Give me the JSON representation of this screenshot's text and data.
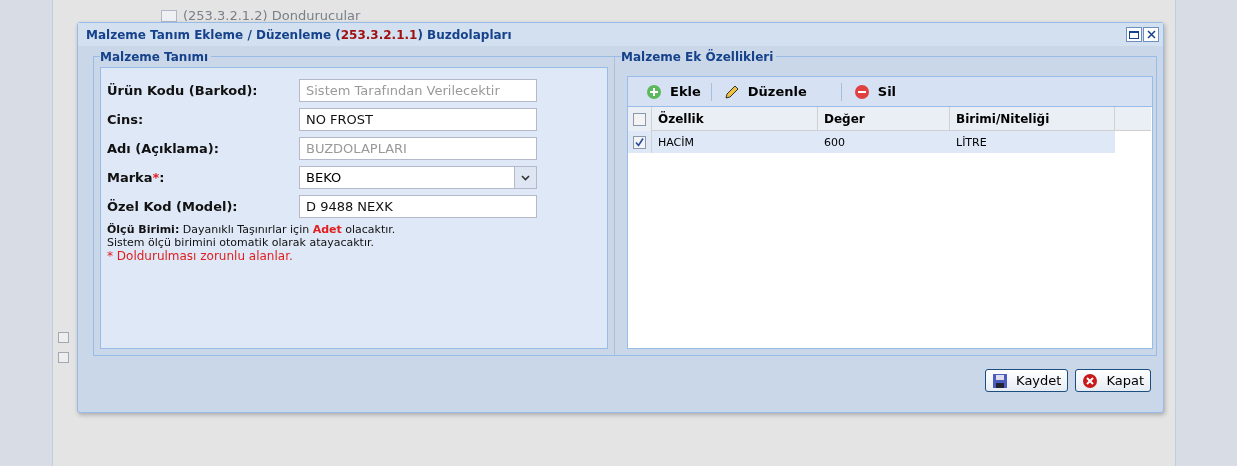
{
  "background_tree": {
    "items": [
      {
        "code": "(253.3.2.1.2)",
        "label": "Dondurucular"
      }
    ]
  },
  "dialog": {
    "title_prefix": "Malzeme Tanım Ekleme / Düzenleme (",
    "title_code": "253.3.2.1.1",
    "title_suffix": ") Buzdolapları",
    "left_panel": {
      "legend": "Malzeme Tanımı",
      "fields": [
        {
          "kind": "text",
          "label": "Ürün Kodu (Barkod):",
          "placeholder": "Sistem Tarafından Verilecektir"
        },
        {
          "kind": "text",
          "label": "Cins:",
          "value": "NO FROST"
        },
        {
          "kind": "text",
          "label": "Adı (Açıklama):",
          "placeholder": "BUZDOLAPLARI"
        },
        {
          "kind": "select",
          "label": "Marka",
          "required_mark": "*",
          "label_end": ":",
          "value": "BEKO"
        },
        {
          "kind": "text",
          "label": "Özel Kod (Model):",
          "value": "D 9488 NEXK"
        }
      ],
      "note": "**Ölçü Birimi:** Dayanıklı Taşınırlar için **Adet** olacaktır.",
      "note_2": "Sistem ölçü birimini otomatik olarak atayacaktır.",
      "required_note": "* Doldurulması zorunlu alanlar."
    },
    "right_panel": {
      "legend": "Malzeme Ek Özellikleri",
      "toolbar": [
        {
          "kind": "add",
          "label": "Ekle"
        },
        {
          "kind": "edit",
          "label": "Düzenle"
        },
        {
          "kind": "delete",
          "label": "Sil"
        }
      ],
      "table": {
        "all_checked": false,
        "columns": [
          "Özellik",
          "Değer",
          "Birimi/Niteliği"
        ],
        "rows": [
          {
            "checked": true,
            "cells": [
              "HACİM",
              "600",
              "LİTRE"
            ]
          }
        ]
      }
    },
    "buttons": [
      {
        "kind": "save",
        "label": "Kaydet"
      },
      {
        "kind": "close",
        "label": "Kapat"
      }
    ]
  }
}
